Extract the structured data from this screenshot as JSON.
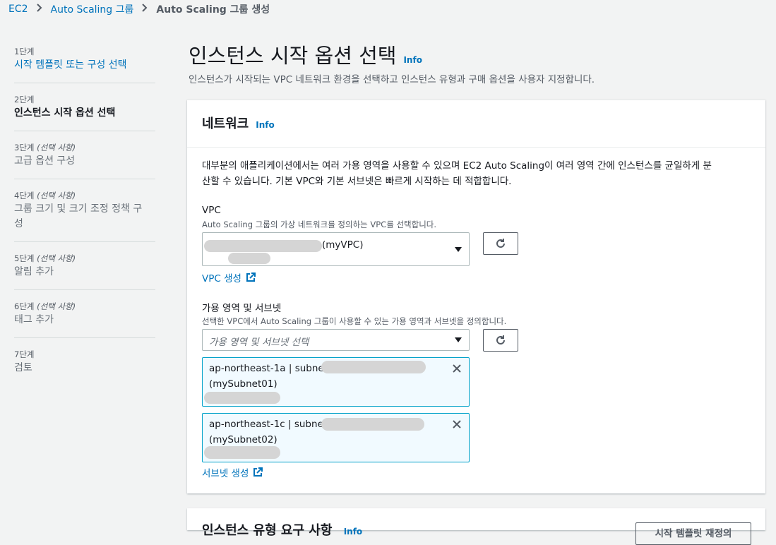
{
  "breadcrumb": {
    "items": [
      "EC2",
      "Auto Scaling 그룹"
    ],
    "current": "Auto Scaling 그룹 생성"
  },
  "sidebar": {
    "steps": [
      {
        "num": "1단계",
        "optional": "",
        "title": "시작 템플릿 또는 구성 선택"
      },
      {
        "num": "2단계",
        "optional": "",
        "title": "인스턴스 시작 옵션 선택"
      },
      {
        "num": "3단계",
        "optional": "(선택 사항)",
        "title": "고급 옵션 구성"
      },
      {
        "num": "4단계",
        "optional": "(선택 사항)",
        "title_line1": "그룹 크기 및 크기 조정 정책 구",
        "title_line2": "성"
      },
      {
        "num": "5단계",
        "optional": "(선택 사항)",
        "title": "알림 추가"
      },
      {
        "num": "6단계",
        "optional": "(선택 사항)",
        "title": "태그 추가"
      },
      {
        "num": "7단계",
        "optional": "",
        "title": "검토"
      }
    ]
  },
  "header": {
    "title": "인스턴스 시작 옵션 선택",
    "info": "Info",
    "description": "인스턴스가 시작되는 VPC 네트워크 환경을 선택하고 인스턴스 유형과 구매 옵션을 사용자 지정합니다."
  },
  "network": {
    "title": "네트워크",
    "info": "Info",
    "description_line1": "대부분의 애플리케이션에서는 여러 가용 영역을 사용할 수 있으며 EC2 Auto Scaling이 여러 영역 간에 인스턴스를 균일하게 분",
    "description_line2": "산할 수 있습니다. 기본 VPC와 기본 서브넷은 빠르게 시작하는 데 적합합니다.",
    "vpc": {
      "label": "VPC",
      "sublabel": "Auto Scaling 그룹의 가상 네트워크를 정의하는 VPC를 선택합니다.",
      "selected": "(myVPC)",
      "create_link": "VPC 생성"
    },
    "subnets": {
      "label": "가용 영역 및 서브넷",
      "sublabel": "선택한 VPC에서 Auto Scaling 그룹이 사용할 수 있는 가용 영역과 서브넷을 정의합니다.",
      "placeholder": "가용 영역 및 서브넷 선택",
      "tokens": [
        {
          "line1": "ap-northeast-1a | subnet",
          "line2": "(mySubnet01)"
        },
        {
          "line1": "ap-northeast-1c | subnet",
          "line2": "(mySubnet02)"
        }
      ],
      "create_link": "서브넷 생성"
    }
  },
  "instance_type": {
    "title": "인스턴스 유형 요구 사항",
    "info": "Info",
    "button": "시작 템플릿 재정의"
  },
  "colors": {
    "link": "#0073bb",
    "token_border": "#00a1c9",
    "token_bg": "#f1faff"
  }
}
